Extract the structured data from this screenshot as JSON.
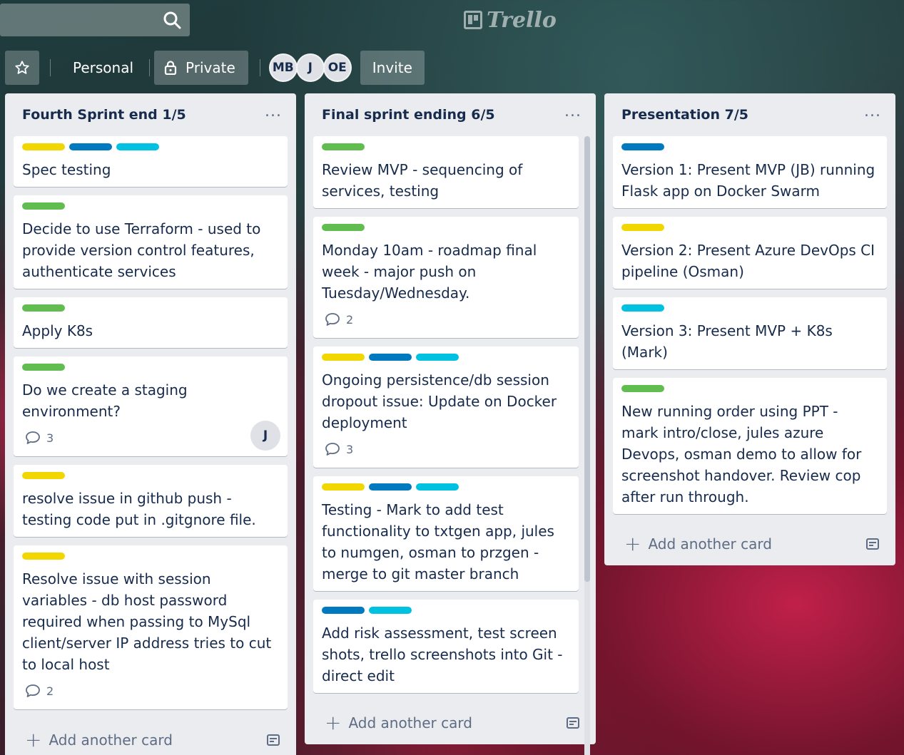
{
  "colors": {
    "green": "#61bd4f",
    "yellow": "#f2d600",
    "blue": "#0079bf",
    "sky": "#00c2e0"
  },
  "header": {
    "logo": "Trello",
    "workspace": "Personal",
    "visibility": "Private",
    "members": [
      "MB",
      "J",
      "OE"
    ],
    "invite": "Invite"
  },
  "lists": [
    {
      "title": "Fourth Sprint end 1/5",
      "menu": "...",
      "add_card": "Add another card",
      "cards": [
        {
          "title": "Spec testing",
          "labels": [
            "yellow",
            "blue",
            "sky"
          ]
        },
        {
          "title": "Decide to use Terraform - used to provide version control features, authenticate services",
          "labels": [
            "green"
          ]
        },
        {
          "title": "Apply K8s",
          "labels": [
            "green"
          ]
        },
        {
          "title": "Do we create a staging environment?",
          "labels": [
            "green"
          ],
          "comments": "3",
          "member": "J"
        },
        {
          "title": "resolve issue in github push - testing code put in .gitgnore file.",
          "labels": [
            "yellow"
          ]
        },
        {
          "title": "Resolve issue with session variables - db host password required when passing to MySql client/server IP address tries to cut to local host",
          "labels": [
            "yellow"
          ],
          "comments": "2"
        }
      ]
    },
    {
      "title": "Final sprint ending 6/5",
      "menu": "...",
      "add_card": "Add another card",
      "cards": [
        {
          "title": "Review MVP - sequencing of services, testing",
          "labels": [
            "green"
          ]
        },
        {
          "title": "Monday 10am - roadmap final week - major push on Tuesday/Wednesday.",
          "labels": [
            "green"
          ],
          "comments": "2"
        },
        {
          "title": "Ongoing persistence/db session dropout issue: Update on Docker deployment",
          "labels": [
            "yellow",
            "blue",
            "sky"
          ],
          "comments": "3"
        },
        {
          "title": "Testing - Mark to add test functionality to txtgen app, jules to numgen, osman to przgen - merge to git master branch",
          "labels": [
            "yellow",
            "blue",
            "sky"
          ]
        },
        {
          "title": "Add risk assessment, test screen shots, trello screenshots into Git - direct edit",
          "labels": [
            "blue",
            "sky"
          ]
        }
      ]
    },
    {
      "title": "Presentation 7/5",
      "menu": "...",
      "add_card": "Add another card",
      "cards": [
        {
          "title": "Version 1: Present MVP (JB) running Flask app on Docker Swarm",
          "labels": [
            "blue"
          ]
        },
        {
          "title": "Version 2: Present Azure DevOps CI pipeline (Osman)",
          "labels": [
            "yellow"
          ]
        },
        {
          "title": "Version 3: Present MVP + K8s (Mark)",
          "labels": [
            "sky"
          ]
        },
        {
          "title": "New running order using PPT - mark intro/close, jules azure Devops, osman demo to allow for screenshot handover. Review cop after run through.",
          "labels": [
            "green"
          ]
        }
      ]
    }
  ]
}
